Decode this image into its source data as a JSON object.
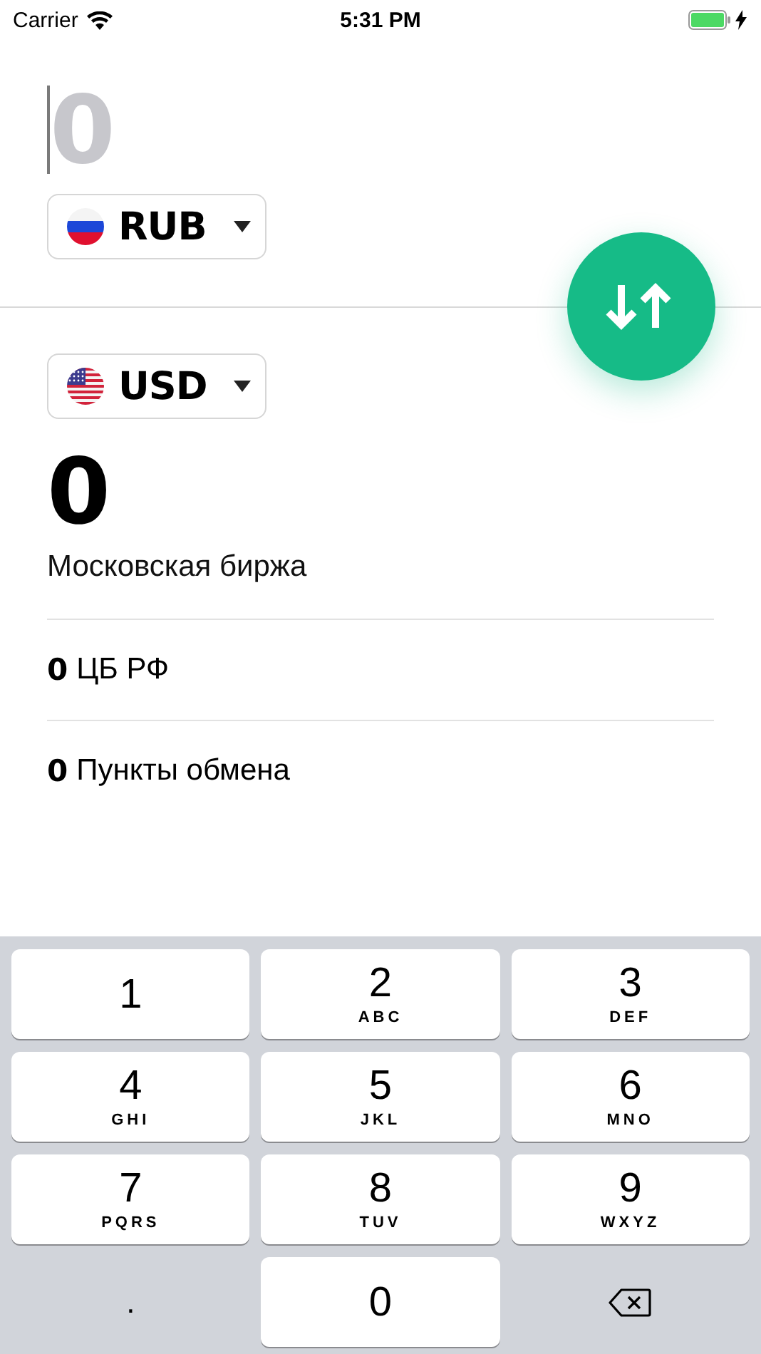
{
  "status_bar": {
    "carrier": "Carrier",
    "time": "5:31 PM"
  },
  "source": {
    "placeholder": "0",
    "currency": "RUB"
  },
  "target": {
    "currency": "USD"
  },
  "rates": [
    {
      "kind": "primary",
      "value": "0",
      "label": "Московская биржа"
    },
    {
      "kind": "secondary",
      "value": "0",
      "label": "ЦБ РФ"
    },
    {
      "kind": "secondary",
      "value": "0",
      "label": "Пункты обмена"
    }
  ],
  "keypad": [
    {
      "kind": "digit",
      "digit": "1"
    },
    {
      "kind": "digit",
      "digit": "2",
      "letters": "ABC"
    },
    {
      "kind": "digit",
      "digit": "3",
      "letters": "DEF"
    },
    {
      "kind": "digit",
      "digit": "4",
      "letters": "GHI"
    },
    {
      "kind": "digit",
      "digit": "5",
      "letters": "JKL"
    },
    {
      "kind": "digit",
      "digit": "6",
      "letters": "MNO"
    },
    {
      "kind": "digit",
      "digit": "7",
      "letters": "PQRS"
    },
    {
      "kind": "digit",
      "digit": "8",
      "letters": "TUV"
    },
    {
      "kind": "digit",
      "digit": "9",
      "letters": "WXYZ"
    },
    {
      "kind": "plain",
      "digit": "."
    },
    {
      "kind": "digit",
      "digit": "0"
    },
    {
      "kind": "backspace"
    }
  ]
}
